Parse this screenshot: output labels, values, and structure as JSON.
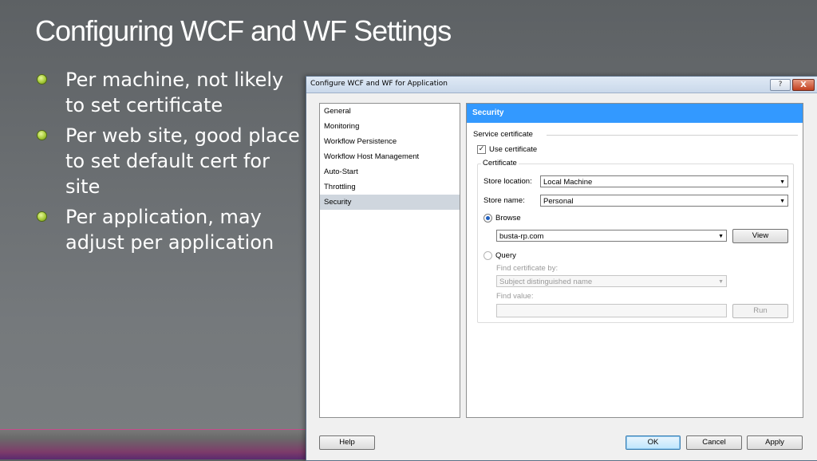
{
  "slide": {
    "title": "Configuring WCF and WF Settings",
    "bullets": [
      "Per machine, not likely to set certificate",
      "Per web site, good place to set default cert for site",
      "Per application, may adjust per application"
    ]
  },
  "dialog": {
    "title": "Configure WCF and WF for Application",
    "help_glyph": "?",
    "close_glyph": "X",
    "nav_items": [
      "General",
      "Monitoring",
      "Workflow Persistence",
      "Workflow Host Management",
      "Auto-Start",
      "Throttling",
      "Security"
    ],
    "selected_nav": "Security",
    "section_header": "Security",
    "service_certificate_label": "Service certificate",
    "use_certificate_label": "Use certificate",
    "use_certificate_checked": true,
    "certificate_group_label": "Certificate",
    "store_location_label": "Store location:",
    "store_location_value": "Local Machine",
    "store_name_label": "Store name:",
    "store_name_value": "Personal",
    "browse_label": "Browse",
    "browse_value": "busta-rp.com",
    "view_button": "View",
    "query_label": "Query",
    "find_certificate_by_label": "Find certificate by:",
    "find_certificate_by_value": "Subject distinguished name",
    "find_value_label": "Find value:",
    "find_value": "",
    "run_button": "Run",
    "help_button": "Help",
    "ok_button": "OK",
    "cancel_button": "Cancel",
    "apply_button": "Apply",
    "arrow_glyph": "▼",
    "check_glyph": "✓"
  }
}
